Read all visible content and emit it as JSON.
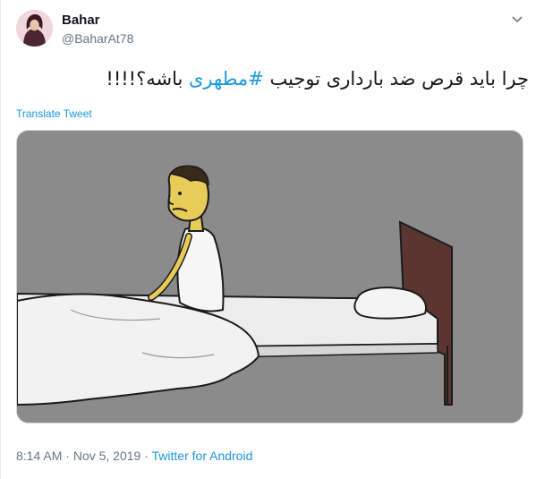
{
  "user": {
    "display_name": "Bahar",
    "handle": "@BaharAt78"
  },
  "tweet": {
    "text_before": "چرا باید قرص ضد بارداری توجیب ",
    "hashtag": "#مطهری",
    "text_after": " باشه؟!!!!",
    "translate_label": "Translate Tweet"
  },
  "meta": {
    "time": "8:14 AM",
    "separator1": " · ",
    "date": "Nov 5, 2019",
    "separator2": " · ",
    "source": "Twitter for Android"
  },
  "icons": {
    "menu": "chevron-down-icon",
    "avatar": "profile-avatar"
  },
  "colors": {
    "link": "#1b95e0",
    "text": "#14171a",
    "muted": "#657786"
  }
}
